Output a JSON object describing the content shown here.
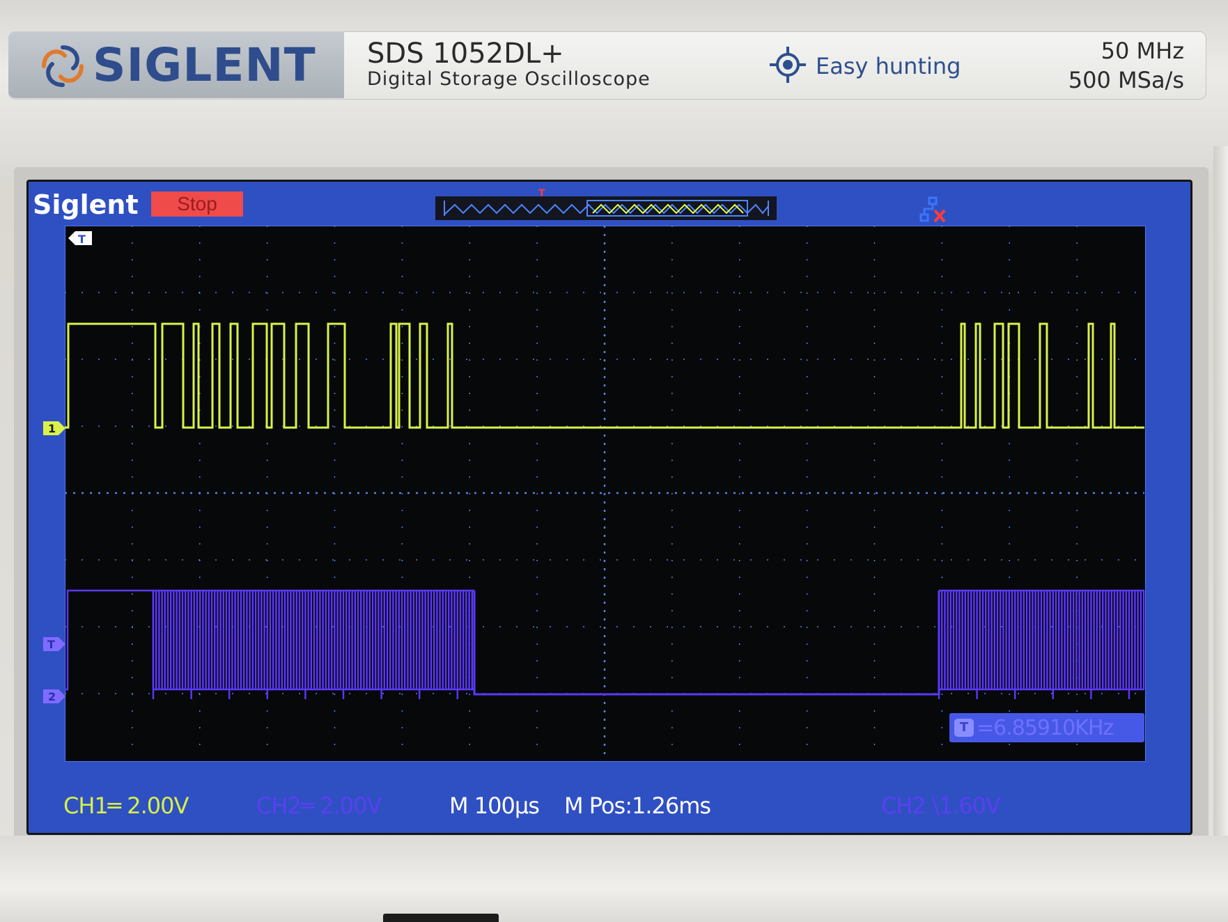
{
  "header": {
    "brand": "SIGLENT",
    "model": "SDS 1052DL+",
    "subtitle": "Digital Storage Oscilloscope",
    "feature": "Easy hunting",
    "bandwidth": "50 MHz",
    "sample_rate": "500 MSa/s"
  },
  "screen": {
    "brand": "Siglent",
    "run_state": "Stop",
    "markers": {
      "ch1": "1",
      "ch2": "2",
      "trigger": "T"
    },
    "frequency_readout": "=6.85910KHz",
    "frequency_icon": "T",
    "status_bar": {
      "ch1_scale": "CH1═ 2.00V",
      "ch2_scale": "CH2═ 2.00V",
      "timebase": "M 100µs",
      "mpos": "M Pos:1.26ms",
      "trigger": "CH2 \\1.60V"
    }
  },
  "colors": {
    "ch1": "#d9f24a",
    "ch2": "#5b38ff",
    "grid": "#4f86e8",
    "screen_frame": "#2f50c2",
    "stop_badge": "#ef4b4b"
  },
  "icons": {
    "logo": "siglent-swirl-icon",
    "easy_hunting": "crosshair-icon",
    "usb": "network-icon"
  }
}
